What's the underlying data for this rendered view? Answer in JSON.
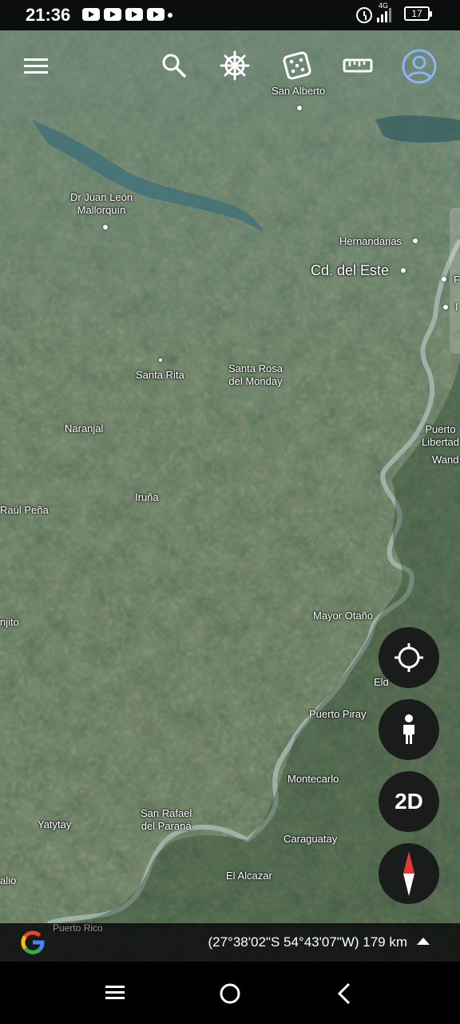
{
  "status_bar": {
    "time": "21:36",
    "network": "4G",
    "battery": "17"
  },
  "toolbar": {
    "icons": [
      "menu-icon",
      "search-icon",
      "ship-wheel-icon",
      "dice-icon",
      "ruler-icon",
      "account-icon"
    ]
  },
  "map": {
    "labels": {
      "san_alberto": "San Alberto",
      "dr_juan_leon": "Dr Juan León\nMallorquín",
      "hernandarias": "Hernandarias",
      "cd_del_este": "Cd. del Este",
      "santa_rita": "Santa Rita",
      "santa_rosa": "Santa Rosa\ndel Monday",
      "naranjal": "Naranjal",
      "puerto_libertad": "Puerto\nLibertad",
      "wanda": "Wand",
      "raul_pena": "Raúl Peña",
      "iruna": "Iruña",
      "njito": "njito",
      "mayor_otano": "Mayor Otaño",
      "eldorado": "Eld",
      "puerto_piray": "Puerto Piray",
      "montecarlo": "Montecarlo",
      "yatytay": "Yatytay",
      "san_rafael": "San Rafael\ndel Paraná",
      "caraguatay": "Caraguatay",
      "alio": "alio",
      "el_alcazar": "El Alcazar",
      "puerto_rico": "Puerto Rico",
      "f_edge": "F",
      "i_edge": "I"
    }
  },
  "controls": {
    "mode_label": "2D"
  },
  "footer": {
    "coordinates": "(27°38'02\"S 54°43'07\"W) 179 km"
  }
}
